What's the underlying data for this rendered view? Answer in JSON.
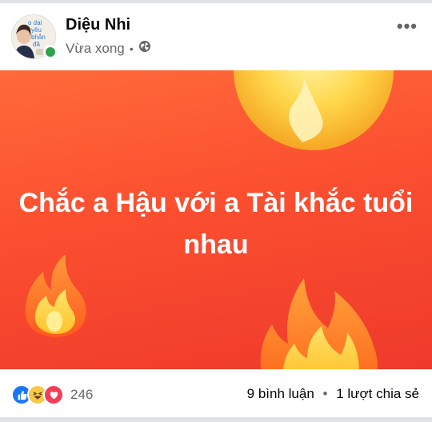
{
  "post": {
    "author": "Diệu Nhi",
    "time": "Vừa xong",
    "privacy_icon": "globe-icon",
    "text": "Chắc a Hậu với a Tài khắc tuổi nhau",
    "background_colors": [
      "#ff6a3a",
      "#ee3a2b"
    ]
  },
  "avatar_text": {
    "line1": "o dại",
    "line2": "yêu",
    "line3": "bhắn",
    "line4": "đã"
  },
  "engagement": {
    "reaction_icons": [
      "like-icon",
      "haha-icon",
      "love-icon"
    ],
    "reaction_count": "246",
    "comments": "9 bình luận",
    "shares": "1 lượt chia sẻ"
  }
}
